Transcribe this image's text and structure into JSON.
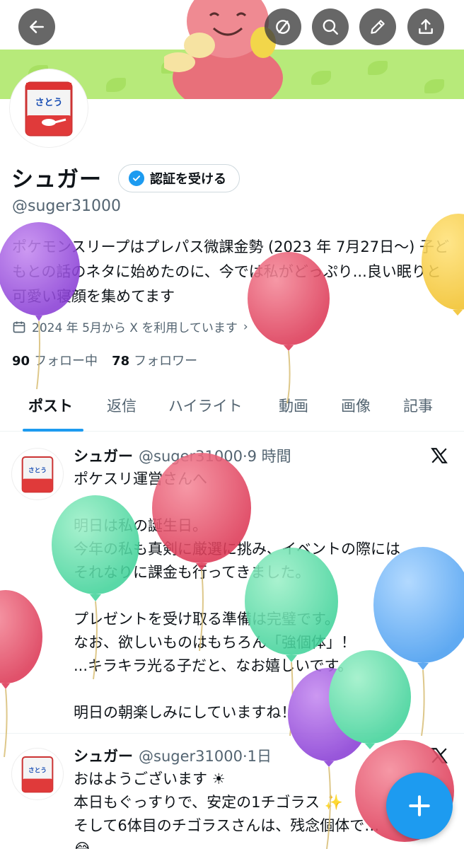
{
  "header": {
    "back_icon": "arrow-left-icon",
    "actions": [
      "circle-slash-icon",
      "search-icon",
      "pencil-icon",
      "share-icon"
    ]
  },
  "profile": {
    "name": "シュガー",
    "verify_label": "認証を受ける",
    "handle": "@suger31000",
    "bio": "ポケモンスリープはプレパス微課金勢 (2023 年 7月27日〜) 子どもとの話のネタに始めたのに、今では私がどっぷり...良い眠りと可愛い寝顔を集めてます",
    "joined": "2024 年 5月から X を利用しています",
    "following_count": "90",
    "following_label": "フォロー中",
    "followers_count": "78",
    "followers_label": "フォロワー",
    "avatar_text": "さとう"
  },
  "tabs": [
    "ポスト",
    "返信",
    "ハイライト",
    "動画",
    "画像",
    "記事"
  ],
  "posts": [
    {
      "name": "シュガー",
      "handle": "@suger31000",
      "time": "·9 時間",
      "body": "ポケスリ運営さんへ\n\n明日は私の誕生日。\n今年の私も真剣に厳選に挑み、イベントの際には\nそれなりに課金も行ってきました。\n\nプレゼントを受け取る準備は完璧です。\nなお、欲しいものはもちろん「強個体」！\n...キラキラ光る子だと、なお嬉しいです。\n\n明日の朝楽しみにしていますね！"
    },
    {
      "name": "シュガー",
      "handle": "@suger31000",
      "time": "·1日",
      "body": "おはようございます ☀\n本日もぐっすりで、安定の1チゴラス ✨\nそして6体目のチゴラスさんは、残念個体で…\n😂"
    }
  ],
  "colors": {
    "accent": "#1d9bf0",
    "banner_green": "#b7ea7a"
  }
}
